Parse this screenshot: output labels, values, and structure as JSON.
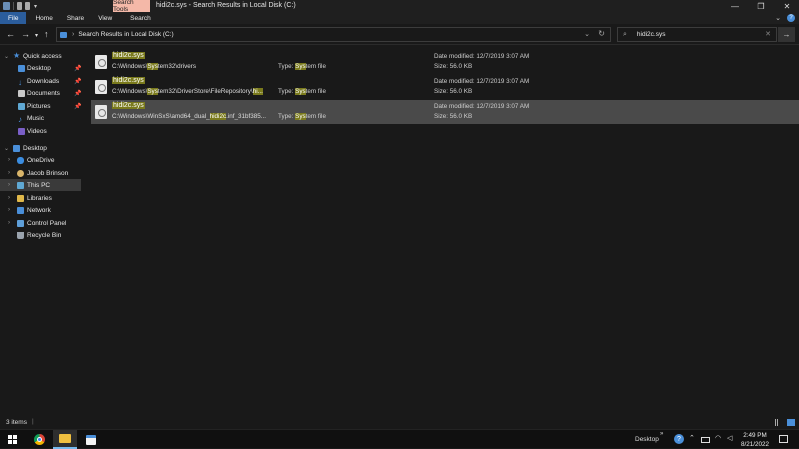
{
  "window": {
    "context_tab": "Search Tools",
    "title": "hidi2c.sys - Search Results in Local Disk (C:)",
    "minimize": "—",
    "maximize": "❐",
    "close": "✕"
  },
  "ribbon": {
    "tabs": [
      "File",
      "Home",
      "Share",
      "View",
      "Search"
    ]
  },
  "address": {
    "path": "Search Results in Local Disk (C:)",
    "search_value": "hidi2c.sys"
  },
  "sidebar": {
    "quick_access": "Quick access",
    "qa_items": [
      "Desktop",
      "Downloads",
      "Documents",
      "Pictures",
      "Music",
      "Videos"
    ],
    "desktop": "Desktop",
    "tree": [
      "OneDrive",
      "Jacob Brinson",
      "This PC",
      "Libraries",
      "Network",
      "Control Panel",
      "Recycle Bin"
    ]
  },
  "results": [
    {
      "name": "hidi2c.sys",
      "path_pre": "C:\\Windows\\",
      "path_hl": "Sys",
      "path_post": "tem32\\drivers",
      "path_hl2": "",
      "type_label": "Type: ",
      "type_hl": "Sys",
      "type_post": "tem file",
      "date": "Date modified: 12/7/2019 3:07 AM",
      "size": "Size: 56.0 KB"
    },
    {
      "name": "hidi2c.sys",
      "path_pre": "C:\\Windows\\",
      "path_hl": "Sys",
      "path_post": "tem32\\DriverStore\\FileRepository\\",
      "path_hl2": "hi...",
      "type_label": "Type: ",
      "type_hl": "Sys",
      "type_post": "tem file",
      "date": "Date modified: 12/7/2019 3:07 AM",
      "size": "Size: 56.0 KB"
    },
    {
      "name": "hidi2c.sys",
      "path_pre": "C:\\Windows\\WinSxS\\amd64_dual_",
      "path_hl": "hidi2c",
      "path_post": ".inf_31bf385...",
      "path_hl2": "",
      "type_label": "Type: ",
      "type_hl": "Sys",
      "type_post": "tem file",
      "date": "Date modified: 12/7/2019 3:07 AM",
      "size": "Size: 56.0 KB"
    }
  ],
  "status": {
    "count": "3 items"
  },
  "taskbar": {
    "desktop_label": "Desktop",
    "time": "2:49 PM",
    "date": "8/21/2022"
  },
  "colors": {
    "file_tab": "#2b5d9c",
    "context_tab": "#f4b8a8",
    "highlight": "#7a7a1c",
    "selected_row": "#4a4a4a"
  }
}
